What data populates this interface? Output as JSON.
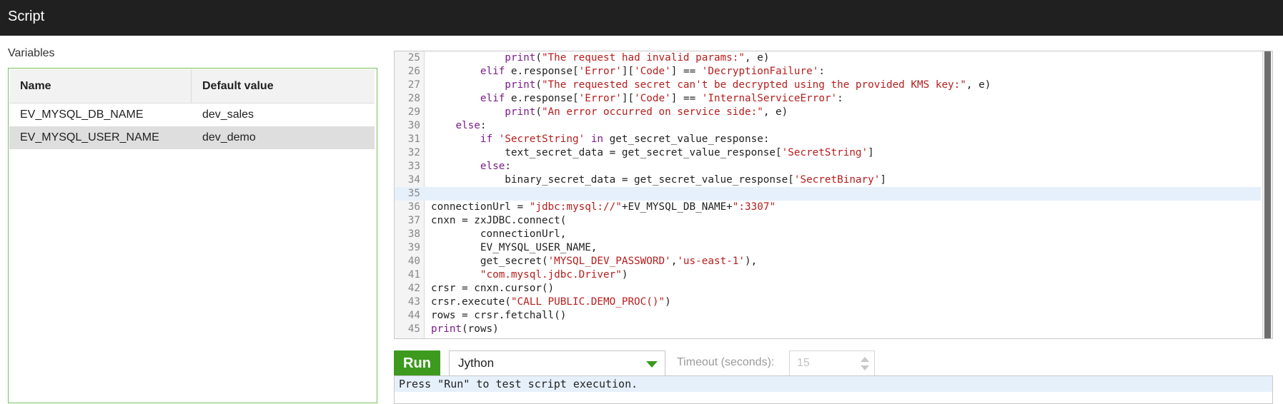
{
  "header": {
    "title": "Script"
  },
  "variables": {
    "label": "Variables",
    "columns": [
      "Name",
      "Default value"
    ],
    "rows": [
      {
        "name": "EV_MYSQL_DB_NAME",
        "default": "dev_sales"
      },
      {
        "name": "EV_MYSQL_USER_NAME",
        "default": "dev_demo"
      }
    ]
  },
  "editor": {
    "lines": [
      {
        "n": "25",
        "indent": "            ",
        "parts": [
          [
            "kw",
            "print"
          ],
          [
            "",
            "("
          ],
          [
            "str",
            "\"The request had invalid params:\""
          ],
          [
            "",
            ", e)"
          ]
        ]
      },
      {
        "n": "26",
        "indent": "        ",
        "parts": [
          [
            "kw",
            "elif"
          ],
          [
            "",
            " e.response["
          ],
          [
            "str",
            "'Error'"
          ],
          [
            "",
            "]["
          ],
          [
            "str",
            "'Code'"
          ],
          [
            "",
            "] == "
          ],
          [
            "str",
            "'DecryptionFailure'"
          ],
          [
            "",
            ":"
          ]
        ]
      },
      {
        "n": "27",
        "indent": "            ",
        "parts": [
          [
            "kw",
            "print"
          ],
          [
            "",
            "("
          ],
          [
            "str",
            "\"The requested secret can't be decrypted using the provided KMS key:\""
          ],
          [
            "",
            ", e)"
          ]
        ]
      },
      {
        "n": "28",
        "indent": "        ",
        "parts": [
          [
            "kw",
            "elif"
          ],
          [
            "",
            " e.response["
          ],
          [
            "str",
            "'Error'"
          ],
          [
            "",
            "]["
          ],
          [
            "str",
            "'Code'"
          ],
          [
            "",
            "] == "
          ],
          [
            "str",
            "'InternalServiceError'"
          ],
          [
            "",
            ":"
          ]
        ]
      },
      {
        "n": "29",
        "indent": "            ",
        "parts": [
          [
            "kw",
            "print"
          ],
          [
            "",
            "("
          ],
          [
            "str",
            "\"An error occurred on service side:\""
          ],
          [
            "",
            ", e)"
          ]
        ]
      },
      {
        "n": "30",
        "indent": "    ",
        "parts": [
          [
            "kw",
            "else"
          ],
          [
            "",
            ":"
          ]
        ]
      },
      {
        "n": "31",
        "indent": "        ",
        "parts": [
          [
            "kw",
            "if"
          ],
          [
            "",
            " "
          ],
          [
            "str",
            "'SecretString'"
          ],
          [
            "",
            " "
          ],
          [
            "kw",
            "in"
          ],
          [
            "",
            " get_secret_value_response:"
          ]
        ]
      },
      {
        "n": "32",
        "indent": "            ",
        "parts": [
          [
            "",
            "text_secret_data = get_secret_value_response["
          ],
          [
            "str",
            "'SecretString'"
          ],
          [
            "",
            "]"
          ]
        ]
      },
      {
        "n": "33",
        "indent": "        ",
        "parts": [
          [
            "kw",
            "else"
          ],
          [
            "",
            ":"
          ]
        ]
      },
      {
        "n": "34",
        "indent": "            ",
        "parts": [
          [
            "",
            "binary_secret_data = get_secret_value_response["
          ],
          [
            "str",
            "'SecretBinary'"
          ],
          [
            "",
            "]"
          ]
        ]
      },
      {
        "n": "35",
        "indent": "",
        "active": true,
        "parts": []
      },
      {
        "n": "36",
        "indent": "",
        "parts": [
          [
            "",
            "connectionUrl = "
          ],
          [
            "str",
            "\"jdbc:mysql://\""
          ],
          [
            "",
            "+EV_MYSQL_DB_NAME+"
          ],
          [
            "str",
            "\":3307\""
          ]
        ]
      },
      {
        "n": "37",
        "indent": "",
        "parts": [
          [
            "",
            "cnxn = zxJDBC.connect("
          ]
        ]
      },
      {
        "n": "38",
        "indent": "        ",
        "parts": [
          [
            "",
            "connectionUrl,"
          ]
        ]
      },
      {
        "n": "39",
        "indent": "        ",
        "parts": [
          [
            "",
            "EV_MYSQL_USER_NAME,"
          ]
        ]
      },
      {
        "n": "40",
        "indent": "        ",
        "parts": [
          [
            "",
            "get_secret("
          ],
          [
            "str",
            "'MYSQL_DEV_PASSWORD'"
          ],
          [
            "",
            ","
          ],
          [
            "str",
            "'us-east-1'"
          ],
          [
            "",
            "),"
          ]
        ]
      },
      {
        "n": "41",
        "indent": "        ",
        "parts": [
          [
            "str",
            "\"com.mysql.jdbc.Driver\""
          ],
          [
            "",
            ")"
          ]
        ]
      },
      {
        "n": "42",
        "indent": "",
        "parts": [
          [
            "",
            "crsr = cnxn.cursor()"
          ]
        ]
      },
      {
        "n": "43",
        "indent": "",
        "parts": [
          [
            "",
            "crsr.execute("
          ],
          [
            "str",
            "\"CALL PUBLIC.DEMO_PROC()\""
          ],
          [
            "",
            ")"
          ]
        ]
      },
      {
        "n": "44",
        "indent": "",
        "parts": [
          [
            "",
            "rows = crsr.fetchall()"
          ]
        ]
      },
      {
        "n": "45",
        "indent": "",
        "parts": [
          [
            "kw",
            "print"
          ],
          [
            "",
            "(rows)"
          ]
        ]
      }
    ]
  },
  "controls": {
    "run_label": "Run",
    "language": "Jython",
    "timeout_label": "Timeout (seconds):",
    "timeout_value": "15"
  },
  "output": {
    "text": "Press \"Run\" to test script execution."
  },
  "colors": {
    "accent": "#3d9a1f",
    "panel_border": "#79c15f",
    "header_bg": "#202020"
  }
}
